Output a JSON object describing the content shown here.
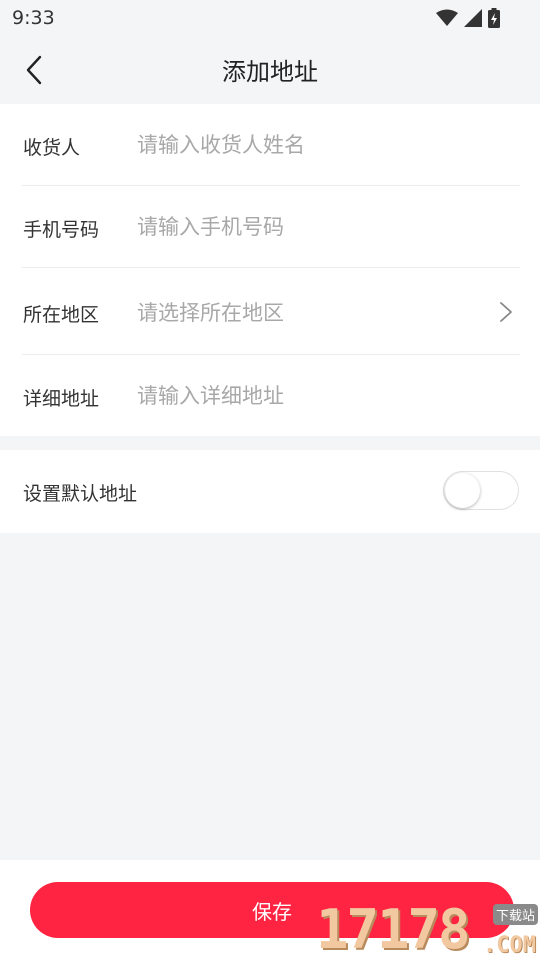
{
  "status_bar": {
    "time": "9:33"
  },
  "header": {
    "title": "添加地址"
  },
  "form": {
    "recipient": {
      "label": "收货人",
      "placeholder": "请输入收货人姓名"
    },
    "phone": {
      "label": "手机号码",
      "placeholder": "请输入手机号码"
    },
    "region": {
      "label": "所在地区",
      "placeholder": "请选择所在地区"
    },
    "address": {
      "label": "详细地址",
      "placeholder": "请输入详细地址"
    }
  },
  "default_address": {
    "label": "设置默认地址",
    "enabled": false
  },
  "footer": {
    "save_label": "保存"
  },
  "watermark": {
    "digits": "17178",
    "tag": "下载站",
    "suffix": ".COM"
  },
  "colors": {
    "accent": "#ff2442",
    "background": "#f4f5f7",
    "placeholder": "#a8a8a8"
  }
}
